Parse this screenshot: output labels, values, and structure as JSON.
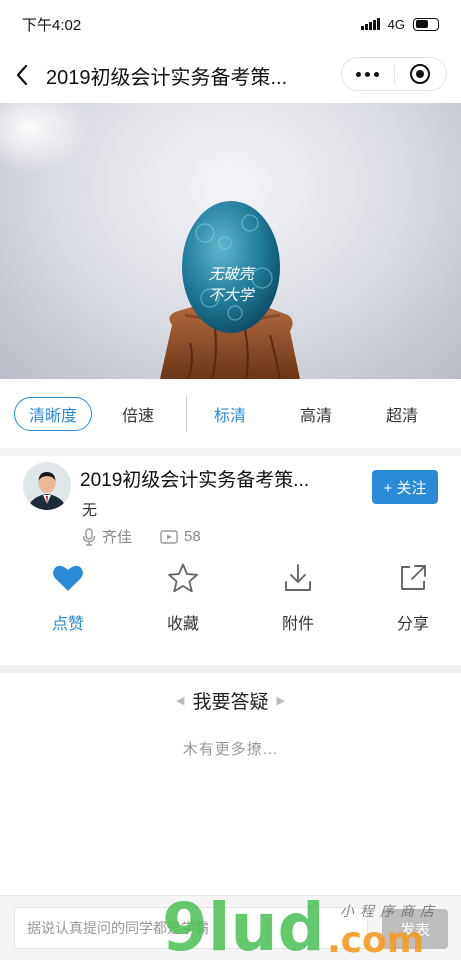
{
  "status_bar": {
    "time": "下午4:02",
    "network": "4G"
  },
  "nav": {
    "title": "2019初级会计实务备考策..."
  },
  "video": {
    "egg_text_line1": "无破壳",
    "egg_text_line2": "不大学"
  },
  "quality": {
    "clarity_label": "清晰度",
    "speed_label": "倍速",
    "options": [
      "标清",
      "高清",
      "超清"
    ],
    "selected": "标清"
  },
  "course": {
    "title": "2019初级会计实务备考策...",
    "follow_label": "+ 关注",
    "description": "无",
    "teacher": "齐佳",
    "play_count": "58"
  },
  "actions": [
    {
      "label": "点赞",
      "icon": "heart-icon",
      "active": true
    },
    {
      "label": "收藏",
      "icon": "star-icon",
      "active": false
    },
    {
      "label": "附件",
      "icon": "download-icon",
      "active": false
    },
    {
      "label": "分享",
      "icon": "share-icon",
      "active": false
    }
  ],
  "qa": {
    "title": "我要答疑",
    "empty_text": "木有更多撩..."
  },
  "comment": {
    "placeholder": "据说认真提问的同学都是学霸",
    "send_label": "发表"
  },
  "watermark": {
    "text": "9lud",
    "suffix": ".com",
    "tag": "小程序商店"
  },
  "colors": {
    "accent": "#2a8ad6",
    "send_disabled": "#bdbdbd",
    "watermark_green": "#4fc25a",
    "watermark_orange": "#f59b23"
  }
}
